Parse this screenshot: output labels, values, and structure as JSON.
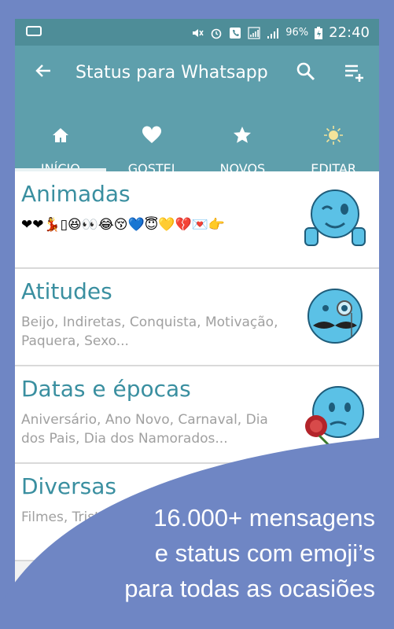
{
  "statusbar": {
    "battery_percent": "96%",
    "time": "22:40"
  },
  "appbar": {
    "title": "Status para Whatsapp",
    "back_icon": "arrow-left-icon",
    "search_icon": "search-icon",
    "menu_icon": "playlist-add-icon"
  },
  "tabs": [
    {
      "label": "INÍCIO",
      "icon": "home-icon",
      "active": true
    },
    {
      "label": "GOSTEI",
      "icon": "heart-icon",
      "active": false
    },
    {
      "label": "NOVOS",
      "icon": "star-icon",
      "active": false
    },
    {
      "label": "EDITAR",
      "icon": "sun-icon",
      "active": false
    }
  ],
  "categories": [
    {
      "title": "Animadas",
      "emojis": "❤❤💃▯😆👀😂😚💙😇💛💔💌👉",
      "icon": "winking-thumbs-up-emoji-icon"
    },
    {
      "title": "Atitudes",
      "desc": "Beijo,  Indiretas, Conquista, Motivação, Paquera, Sexo...",
      "icon": "monocle-mustache-emoji-icon"
    },
    {
      "title": "Datas e épocas",
      "desc": "Aniversário, Ano Novo, Carnaval, Dia dos Pais, Dia dos Namorados...",
      "icon": "rose-emoji-icon"
    },
    {
      "title": "Diversas",
      "desc": "Filmes, Tristeza",
      "icon": "emoji-icon"
    }
  ],
  "promo": {
    "line1": "16.000+ mensagens",
    "line2": "e status com emoji’s",
    "line3": "para todas as ocasiões"
  },
  "colors": {
    "background": "#6f86c4",
    "statusbar": "#4e8d98",
    "appbar": "#5e9fac",
    "accent_text": "#3a8fa0"
  }
}
